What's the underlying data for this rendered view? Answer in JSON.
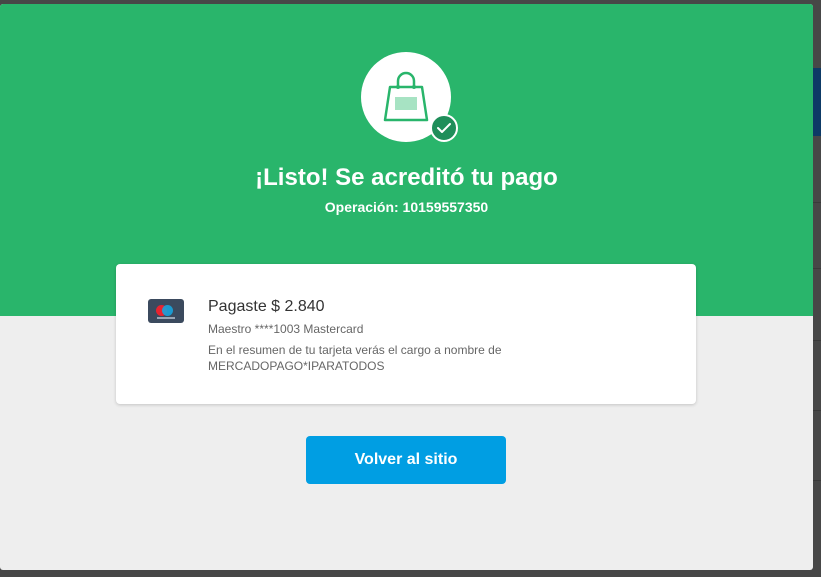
{
  "colors": {
    "success_green": "#29b56b",
    "button_blue": "#009ee3",
    "badge_green": "#1f8e5a"
  },
  "header": {
    "icon": "shopping-bag-icon",
    "badge_icon": "check-icon",
    "title": "¡Listo! Se acreditó tu pago",
    "operation": "Operación: 10159557350"
  },
  "payment": {
    "card_logo": "maestro-card-icon",
    "paid_label": "Pagaste $ 2.840",
    "card_description": "Maestro ****1003 Mastercard",
    "statement_note": "En el resumen de tu tarjeta verás el cargo a nombre de MERCADOPAGO*IPARATODOS"
  },
  "actions": {
    "back_label": "Volver al sitio"
  }
}
